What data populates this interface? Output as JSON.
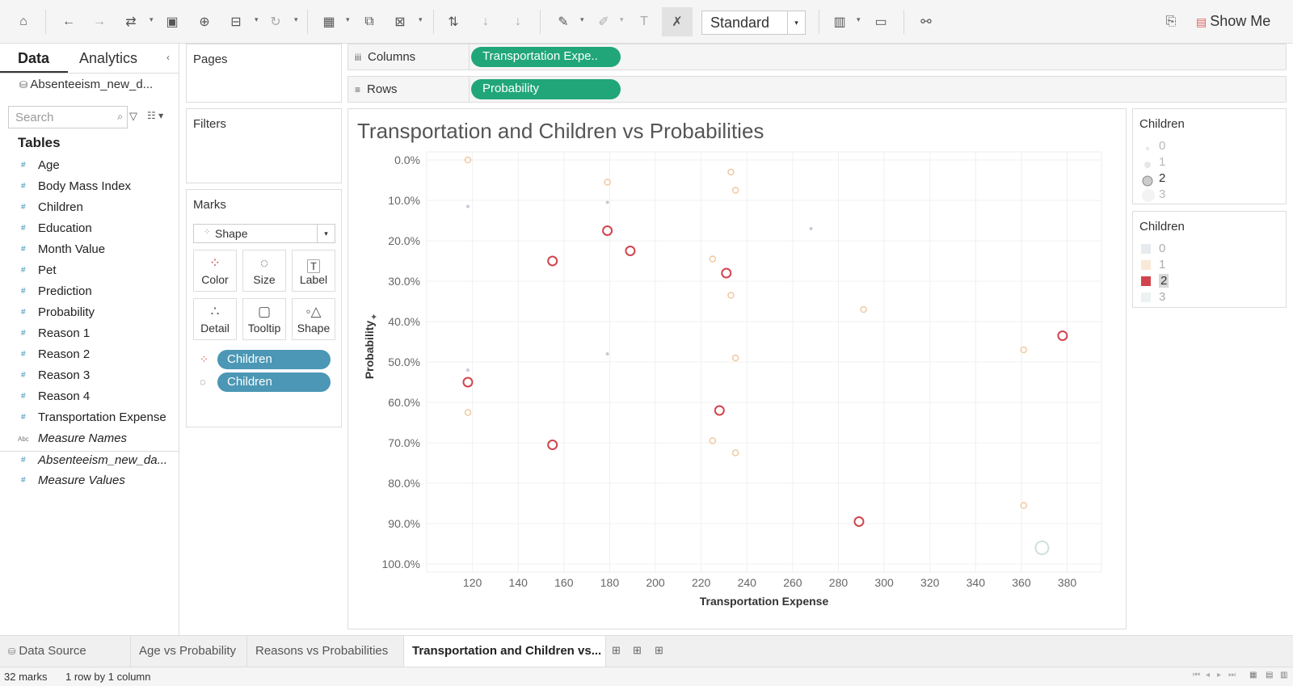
{
  "toolbar": {
    "fit": "Standard",
    "show_me": "Show Me"
  },
  "sidebar": {
    "tab_data": "Data",
    "tab_analytics": "Analytics",
    "datasource": "Absenteeism_new_d...",
    "search_placeholder": "Search",
    "tables_heading": "Tables",
    "fields": [
      {
        "type": "#",
        "name": "Age"
      },
      {
        "type": "#",
        "name": "Body Mass Index"
      },
      {
        "type": "#",
        "name": "Children"
      },
      {
        "type": "#",
        "name": "Education"
      },
      {
        "type": "#",
        "name": "Month Value"
      },
      {
        "type": "#",
        "name": "Pet"
      },
      {
        "type": "#",
        "name": "Prediction"
      },
      {
        "type": "#",
        "name": "Probability"
      },
      {
        "type": "#",
        "name": "Reason 1"
      },
      {
        "type": "#",
        "name": "Reason 2"
      },
      {
        "type": "#",
        "name": "Reason 3"
      },
      {
        "type": "#",
        "name": "Reason 4"
      },
      {
        "type": "#",
        "name": "Transportation Expense"
      },
      {
        "type": "Abc",
        "name": "Measure Names"
      },
      {
        "type": "#",
        "name": "Absenteeism_new_da..."
      },
      {
        "type": "#",
        "name": "Measure Values"
      }
    ]
  },
  "cards": {
    "pages": "Pages",
    "filters": "Filters",
    "marks": "Marks",
    "mark_type": "Shape",
    "buttons": {
      "color": "Color",
      "size": "Size",
      "label": "Label",
      "detail": "Detail",
      "tooltip": "Tooltip",
      "shape": "Shape"
    },
    "pills": [
      "Children",
      "Children"
    ]
  },
  "shelves": {
    "columns_label": "Columns",
    "columns_pill": "Transportation Expe..",
    "rows_label": "Rows",
    "rows_pill": "Probability"
  },
  "legends": {
    "size": {
      "title": "Children",
      "items": [
        "0",
        "1",
        "2",
        "3"
      ]
    },
    "color": {
      "title": "Children",
      "items": [
        "0",
        "1",
        "2",
        "3"
      ]
    }
  },
  "colors": {
    "accent_green": "#21a67a",
    "pill_blue": "#4b97b5",
    "child_0": "#c5ccd8",
    "child_1": "#f0c9a0",
    "child_2": "#d2444d",
    "child_3": "#cfe0de"
  },
  "chart_data": {
    "type": "scatter",
    "title": "Transportation and Children vs Probabilities",
    "xlabel": "Transportation Expense",
    "ylabel": "Probability",
    "xlim": [
      100,
      395
    ],
    "ylim": [
      0,
      1
    ],
    "y_reversed": true,
    "x_ticks": [
      120,
      140,
      160,
      180,
      200,
      220,
      240,
      260,
      280,
      300,
      320,
      340,
      360,
      380
    ],
    "y_ticks": [
      "0.0%",
      "10.0%",
      "20.0%",
      "30.0%",
      "40.0%",
      "50.0%",
      "60.0%",
      "70.0%",
      "80.0%",
      "90.0%",
      "100.0%"
    ],
    "points": [
      {
        "x": 118,
        "y": 0.0,
        "children": 1
      },
      {
        "x": 118,
        "y": 0.115,
        "children": 0
      },
      {
        "x": 118,
        "y": 0.52,
        "children": 0
      },
      {
        "x": 118,
        "y": 0.55,
        "children": 2
      },
      {
        "x": 118,
        "y": 0.625,
        "children": 1
      },
      {
        "x": 155,
        "y": 0.25,
        "children": 2
      },
      {
        "x": 155,
        "y": 0.705,
        "children": 2
      },
      {
        "x": 179,
        "y": 0.055,
        "children": 1
      },
      {
        "x": 179,
        "y": 0.105,
        "children": 0
      },
      {
        "x": 179,
        "y": 0.175,
        "children": 2
      },
      {
        "x": 179,
        "y": 0.48,
        "children": 0
      },
      {
        "x": 189,
        "y": 0.225,
        "children": 2
      },
      {
        "x": 225,
        "y": 0.245,
        "children": 1
      },
      {
        "x": 225,
        "y": 0.695,
        "children": 1
      },
      {
        "x": 228,
        "y": 0.62,
        "children": 2
      },
      {
        "x": 231,
        "y": 0.28,
        "children": 2
      },
      {
        "x": 233,
        "y": 0.03,
        "children": 1
      },
      {
        "x": 233,
        "y": 0.335,
        "children": 1
      },
      {
        "x": 235,
        "y": 0.075,
        "children": 1
      },
      {
        "x": 235,
        "y": 0.49,
        "children": 1
      },
      {
        "x": 235,
        "y": 0.725,
        "children": 1
      },
      {
        "x": 268,
        "y": 0.17,
        "children": 0
      },
      {
        "x": 289,
        "y": 0.895,
        "children": 2
      },
      {
        "x": 291,
        "y": 0.37,
        "children": 1
      },
      {
        "x": 361,
        "y": 0.47,
        "children": 1
      },
      {
        "x": 361,
        "y": 0.855,
        "children": 1
      },
      {
        "x": 369,
        "y": 0.96,
        "children": 3
      },
      {
        "x": 378,
        "y": 0.435,
        "children": 2
      }
    ]
  },
  "sheet_tabs": [
    "Data Source",
    "Age vs Probability",
    "Reasons vs Probabilities",
    "Transportation and Children vs..."
  ],
  "status": {
    "marks": "32 marks",
    "layout": "1 row by 1 column"
  }
}
